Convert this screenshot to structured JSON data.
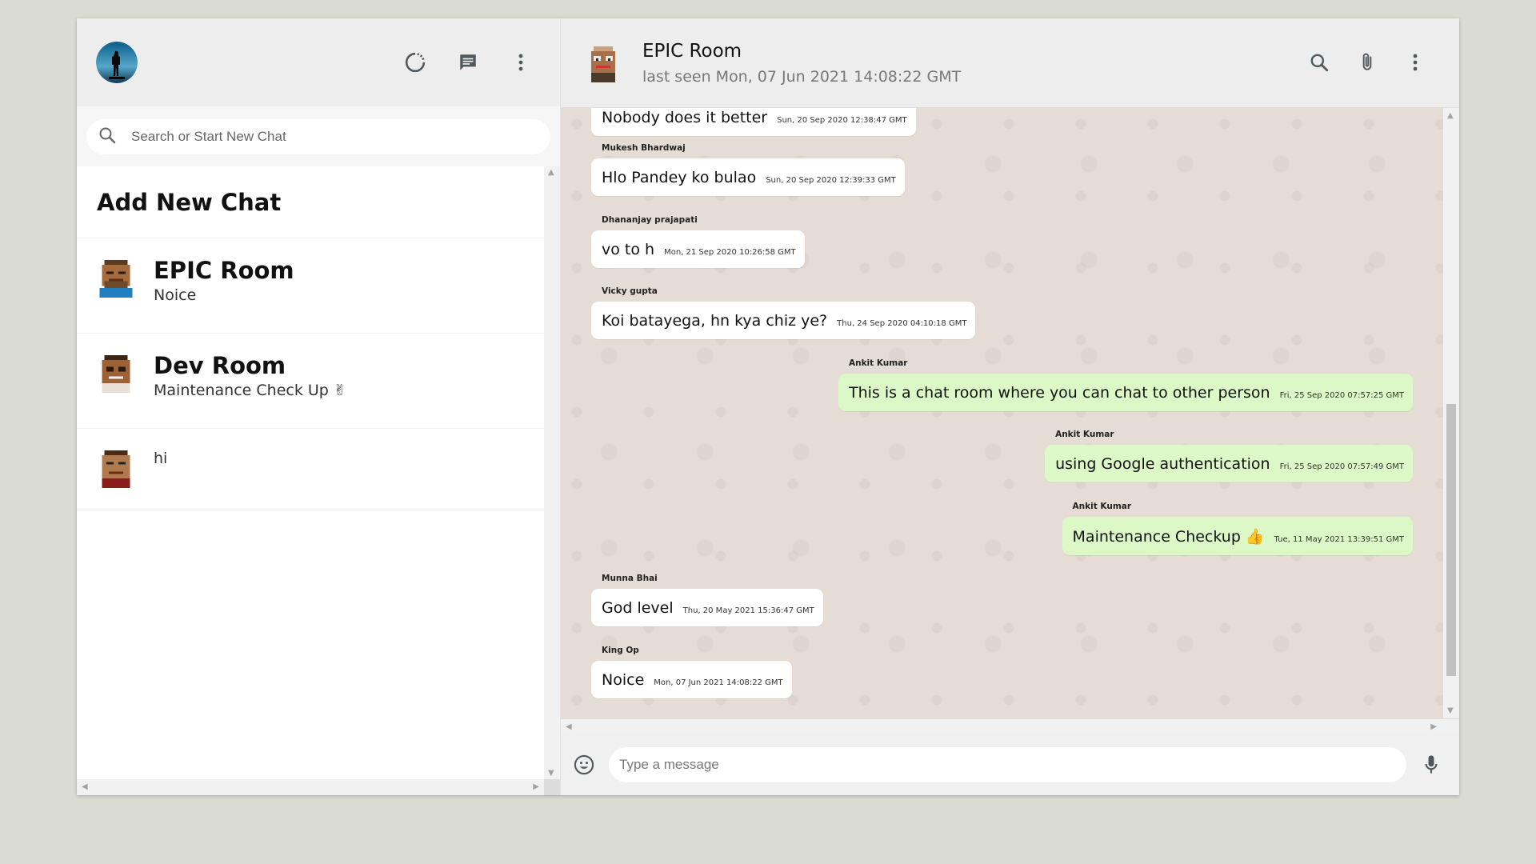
{
  "sidebar": {
    "search_placeholder": "Search or Start New Chat",
    "add_new_chat": "Add New Chat",
    "chats": [
      {
        "name": "EPIC Room",
        "last": "Noice"
      },
      {
        "name": "Dev Room",
        "last": "Maintenance Check Up ✌"
      },
      {
        "name": "",
        "last": "hi"
      }
    ]
  },
  "chat": {
    "room_name": "EPIC Room",
    "last_seen": "last seen Mon, 07 Jun 2021 14:08:22 GMT",
    "messages": [
      {
        "sender": "",
        "text": "Nobody does it better",
        "time": "Sun, 20 Sep 2020 12:38:47 GMT",
        "mine": false
      },
      {
        "sender": "Mukesh Bhardwaj",
        "text": "Hlo Pandey ko bulao",
        "time": "Sun, 20 Sep 2020 12:39:33 GMT",
        "mine": false
      },
      {
        "sender": "Dhananjay prajapati",
        "text": "vo to h",
        "time": "Mon, 21 Sep 2020 10:26:58 GMT",
        "mine": false
      },
      {
        "sender": "Vicky gupta",
        "text": "Koi batayega, hn kya chiz ye?",
        "time": "Thu, 24 Sep 2020 04:10:18 GMT",
        "mine": false
      },
      {
        "sender": "Ankit Kumar",
        "text": "This is a chat room where you can chat to other person",
        "time": "Fri, 25 Sep 2020 07:57:25 GMT",
        "mine": true
      },
      {
        "sender": "Ankit Kumar",
        "text": "using Google authentication",
        "time": "Fri, 25 Sep 2020 07:57:49 GMT",
        "mine": true
      },
      {
        "sender": "Ankit Kumar",
        "text": "Maintenance Checkup 👍",
        "time": "Tue, 11 May 2021 13:39:51 GMT",
        "mine": true
      },
      {
        "sender": "Munna Bhai",
        "text": "God level",
        "time": "Thu, 20 May 2021 15:36:47 GMT",
        "mine": false
      },
      {
        "sender": "King Op",
        "text": "Noice",
        "time": "Mon, 07 Jun 2021 14:08:22 GMT",
        "mine": false
      }
    ],
    "input_placeholder": "Type a message"
  },
  "colors": {
    "background": "#dadbd3",
    "header": "#ededed",
    "outgoing_bubble": "#dcf8c6",
    "incoming_bubble": "#ffffff",
    "chat_wallpaper": "#e5ddd5"
  },
  "icons": [
    "status-icon",
    "new-chat-icon",
    "menu-dots-icon",
    "search-icon",
    "attach-icon",
    "emoji-icon",
    "mic-icon"
  ]
}
